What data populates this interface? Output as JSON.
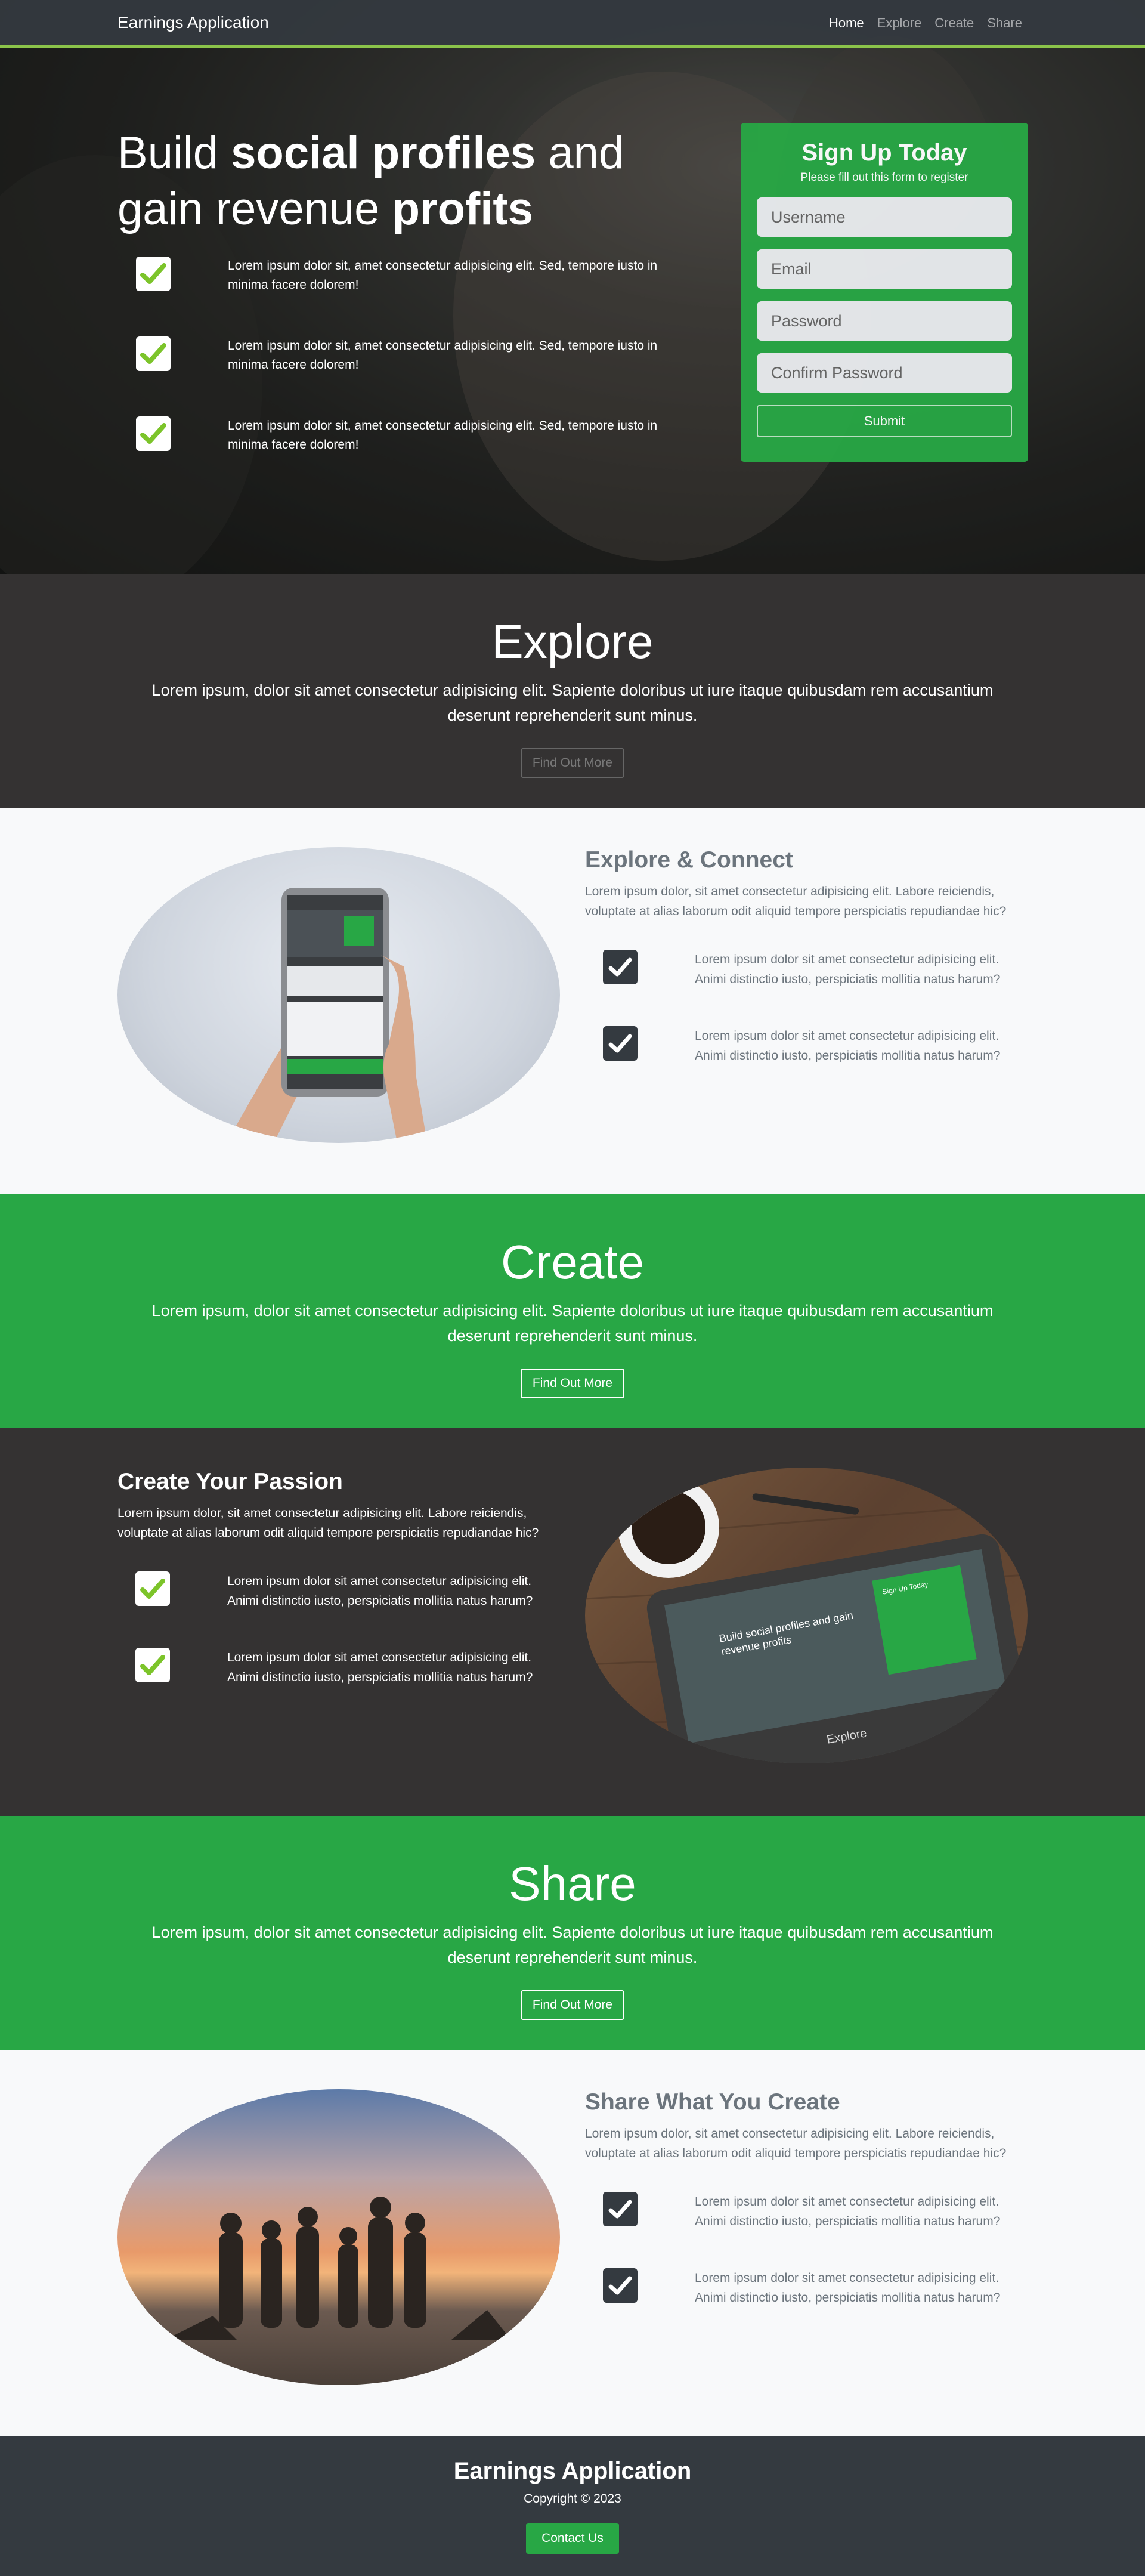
{
  "nav": {
    "brand": "Earnings Application",
    "links": [
      "Home",
      "Explore",
      "Create",
      "Share"
    ]
  },
  "hero": {
    "title_part1": "Build ",
    "title_bold1": "social profiles",
    "title_part2": " and gain revenue ",
    "title_bold2": "profits",
    "features": [
      "Lorem ipsum dolor sit, amet consectetur adipisicing elit. Sed, tempore iusto in minima facere dolorem!",
      "Lorem ipsum dolor sit, amet consectetur adipisicing elit. Sed, tempore iusto in minima facere dolorem!",
      "Lorem ipsum dolor sit, amet consectetur adipisicing elit. Sed, tempore iusto in minima facere dolorem!"
    ]
  },
  "signup": {
    "title": "Sign Up Today",
    "subtitle": "Please fill out this form to register",
    "username_placeholder": "Username",
    "email_placeholder": "Email",
    "password_placeholder": "Password",
    "confirm_placeholder": "Confirm Password",
    "submit": "Submit"
  },
  "explore": {
    "title": "Explore",
    "text": "Lorem ipsum, dolor sit amet consectetur adipisicing elit. Sapiente doloribus ut iure itaque quibusdam rem accusantium deserunt reprehenderit sunt minus.",
    "cta": "Find Out More"
  },
  "explore_connect": {
    "title": "Explore & Connect",
    "lead": "Lorem ipsum dolor, sit amet consectetur adipisicing elit. Labore reiciendis, voluptate at alias laborum odit aliquid tempore perspiciatis repudiandae hic?",
    "items": [
      "Lorem ipsum dolor sit amet consectetur adipisicing elit. Animi distinctio iusto, perspiciatis mollitia natus harum?",
      "Lorem ipsum dolor sit amet consectetur adipisicing elit. Animi distinctio iusto, perspiciatis mollitia natus harum?"
    ]
  },
  "create": {
    "title": "Create",
    "text": "Lorem ipsum, dolor sit amet consectetur adipisicing elit. Sapiente doloribus ut iure itaque quibusdam rem accusantium deserunt reprehenderit sunt minus.",
    "cta": "Find Out More"
  },
  "create_passion": {
    "title": "Create Your Passion",
    "lead": "Lorem ipsum dolor, sit amet consectetur adipisicing elit. Labore reiciendis, voluptate at alias laborum odit aliquid tempore perspiciatis repudiandae hic?",
    "items": [
      "Lorem ipsum dolor sit amet consectetur adipisicing elit. Animi distinctio iusto, perspiciatis mollitia natus harum?",
      "Lorem ipsum dolor sit amet consectetur adipisicing elit. Animi distinctio iusto, perspiciatis mollitia natus harum?"
    ],
    "tablet_title": "Build social profiles and gain revenue profits",
    "tablet_form": "Sign Up Today",
    "tablet_section": "Explore"
  },
  "share": {
    "title": "Share",
    "text": "Lorem ipsum, dolor sit amet consectetur adipisicing elit. Sapiente doloribus ut iure itaque quibusdam rem accusantium deserunt reprehenderit sunt minus.",
    "cta": "Find Out More"
  },
  "share_create": {
    "title": "Share What You Create",
    "lead": "Lorem ipsum dolor, sit amet consectetur adipisicing elit. Labore reiciendis, voluptate at alias laborum odit aliquid tempore perspiciatis repudiandae hic?",
    "items": [
      "Lorem ipsum dolor sit amet consectetur adipisicing elit. Animi distinctio iusto, perspiciatis mollitia natus harum?",
      "Lorem ipsum dolor sit amet consectetur adipisicing elit. Animi distinctio iusto, perspiciatis mollitia natus harum?"
    ]
  },
  "footer": {
    "title": "Earnings Application",
    "copyright": "Copyright © 2023",
    "contact": "Contact Us"
  },
  "colors": {
    "brand_green": "#28a745",
    "check_green": "#8bc34a",
    "dark": "#343232",
    "navbar": "#343a40"
  }
}
